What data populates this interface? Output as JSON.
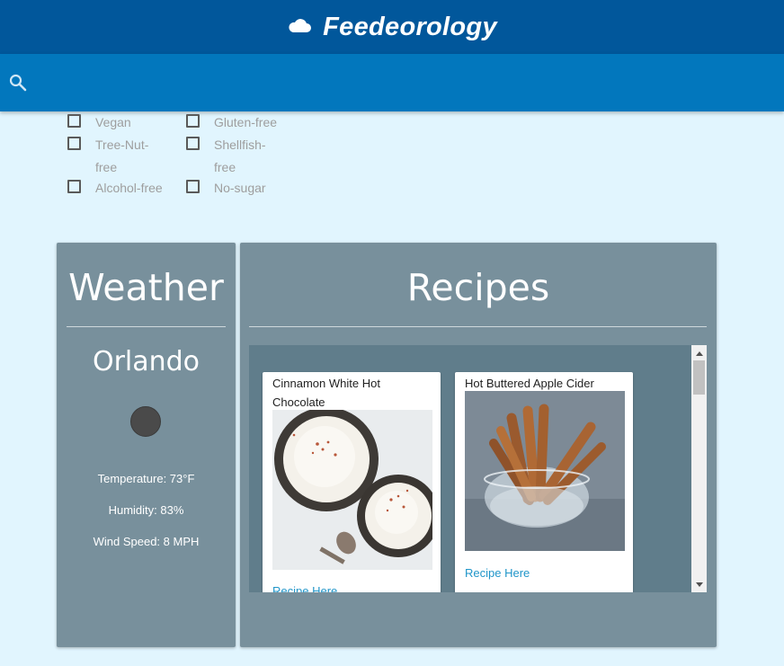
{
  "app": {
    "title": "Feedeorology",
    "logo_icon": "cloud-icon"
  },
  "search": {
    "icon": "search-icon",
    "value": "",
    "placeholder": ""
  },
  "filters": [
    {
      "label": "Vegan",
      "checked": false
    },
    {
      "label": "Gluten-free",
      "checked": false
    },
    {
      "label": "Tree-Nut-free",
      "checked": false
    },
    {
      "label": "Shellfish-free",
      "checked": false
    },
    {
      "label": "Alcohol-free",
      "checked": false
    },
    {
      "label": "No-sugar",
      "checked": false
    }
  ],
  "weather": {
    "title": "Weather",
    "city": "Orlando",
    "icon": "weather-icon",
    "temperature": "Temperature: 73°F",
    "humidity": "Humidity: 83%",
    "wind": "Wind Speed: 8 MPH"
  },
  "recipes": {
    "title": "Recipes",
    "items": [
      {
        "title": "Cinnamon White Hot Chocolate",
        "image": "white-hot-chocolate-photo",
        "link": "Recipe Here"
      },
      {
        "title": "Hot Buttered Apple Cider",
        "image": "cinnamon-sticks-photo",
        "link": "Recipe Here"
      }
    ]
  },
  "colors": {
    "header": "#01579b",
    "searchbar": "#0277bd",
    "background": "#e1f5fe",
    "panel": "#78909c",
    "recipe_area": "#607d8b",
    "link": "#2196c9"
  }
}
